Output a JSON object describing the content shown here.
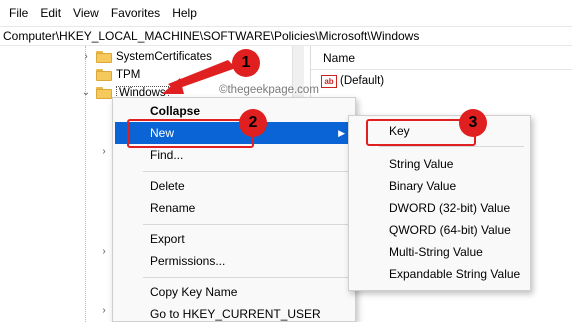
{
  "menubar": [
    "File",
    "Edit",
    "View",
    "Favorites",
    "Help"
  ],
  "address_path": "Computer\\HKEY_LOCAL_MACHINE\\SOFTWARE\\Policies\\Microsoft\\Windows",
  "tree": {
    "items": [
      {
        "label": "SystemCertificates",
        "chevron": "›"
      },
      {
        "label": "TPM",
        "chevron": ""
      },
      {
        "label": "Windows",
        "chevron": "⌄"
      }
    ],
    "expander_glyph": "›"
  },
  "right_pane": {
    "column_header": "Name",
    "value_icon_text": "ab",
    "value_name": "(Default)"
  },
  "watermark": "©thegeekpage.com",
  "context_menu": {
    "collapse": "Collapse",
    "new": "New",
    "find": "Find...",
    "delete": "Delete",
    "rename": "Rename",
    "export": "Export",
    "permissions": "Permissions...",
    "copy_key_name": "Copy Key Name",
    "goto_hkcu": "Go to HKEY_CURRENT_USER",
    "submenu_arrow": "▶"
  },
  "submenu": {
    "key": "Key",
    "string_value": "String Value",
    "binary_value": "Binary Value",
    "dword_value": "DWORD (32-bit) Value",
    "qword_value": "QWORD (64-bit) Value",
    "multi_string_value": "Multi-String Value",
    "expandable_string_value": "Expandable String Value"
  },
  "annotations": {
    "step1": "1",
    "step2": "2",
    "step3": "3",
    "color": "#e02020"
  },
  "colors": {
    "highlight": "#0a64d6",
    "folder": "#f5c95c"
  }
}
